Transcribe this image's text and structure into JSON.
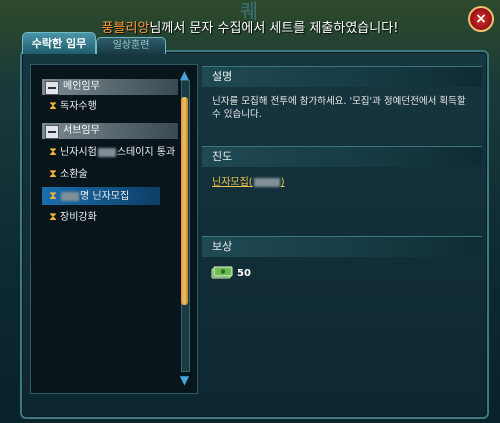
{
  "header": {
    "title_glyph": "퀘",
    "notice_name": "풍블리앙",
    "notice_text": "님께서 문자 수집에서 세트를 제출하였습니다!",
    "close_label": "×"
  },
  "tabs": [
    {
      "label": "수락한 임무"
    },
    {
      "label": "일상훈련"
    }
  ],
  "quest_list": {
    "main_category": "메인임무",
    "main_quests": [
      "독자수행"
    ],
    "sub_category": "서브임무",
    "sub_quests": [
      {
        "prefix": "닌자시험",
        "suffix": "스테이지 통과"
      },
      {
        "prefix": "소환술",
        "suffix": ""
      },
      {
        "prefix": "",
        "suffix": "명 닌자모집"
      },
      {
        "prefix": "장비강화",
        "suffix": ""
      }
    ]
  },
  "detail": {
    "description_title": "설명",
    "description_text": "닌자를 모집해 전투에 참가하세요. '모집'과 정예던전에서 획득할 수 있습니다.",
    "progress_title": "진도",
    "progress_text": "닌자모집(",
    "progress_close": ")",
    "reward_title": "보상",
    "reward_amount": "50"
  },
  "icons": {
    "hourglass": "hourglass-icon",
    "money": "money-icon"
  },
  "colors": {
    "accent_gold": "#f2b33a",
    "notice_name": "#ff9a3a",
    "selected_row": "#1a6fae"
  }
}
